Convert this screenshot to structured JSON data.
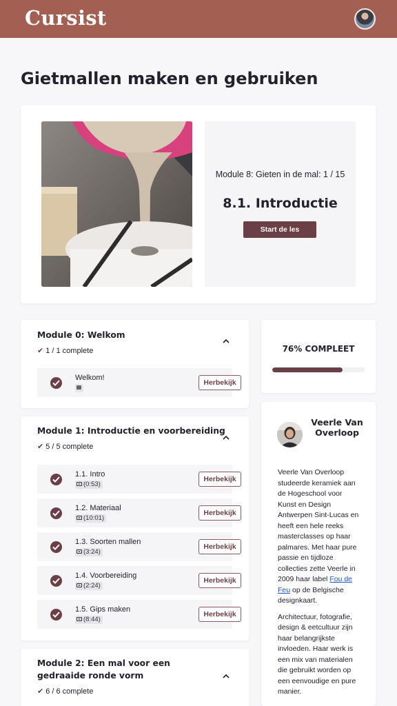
{
  "header": {
    "logo": "Cursist",
    "avatar_icon": "user-avatar"
  },
  "page_title": "Gietmallen maken en gebruiken",
  "hero": {
    "module_label": "Module 8: Gieten in de mal: 1 / 15",
    "lesson_title": "8.1. Introductie",
    "start_label": "Start de les"
  },
  "modules": [
    {
      "title": "Module 0: Welkom",
      "count": "1 / 1 complete",
      "lessons": [
        {
          "title": "Welkom!",
          "duration": "",
          "type": "text",
          "button": "Herbekijk"
        }
      ]
    },
    {
      "title": "Module 1: Introductie en voorbereiding",
      "count": "5 / 5 complete",
      "lessons": [
        {
          "title": "1.1. Intro",
          "duration": "(0:53)",
          "type": "video",
          "button": "Herbekijk"
        },
        {
          "title": "1.2. Materiaal",
          "duration": "(10:01)",
          "type": "video",
          "button": "Herbekijk"
        },
        {
          "title": "1.3. Soorten mallen",
          "duration": "(3:24)",
          "type": "video",
          "button": "Herbekijk"
        },
        {
          "title": "1.4. Voorbereiding",
          "duration": "(2:24)",
          "type": "video",
          "button": "Herbekijk"
        },
        {
          "title": "1.5. Gips maken",
          "duration": "(8:44)",
          "type": "video",
          "button": "Herbekijk"
        }
      ]
    },
    {
      "title": "Module 2: Een mal voor een gedraaide ronde vorm",
      "count": "6 / 6 complete",
      "lessons": []
    }
  ],
  "progress": {
    "label": "76% COMPLEET",
    "percent": 76
  },
  "author": {
    "name": "Veerle Van Overloop",
    "bio_1_pre": "Veerle Van Overloop studeerde keramiek aan de Hogeschool voor Kunst en Design Antwerpen Sint-Lucas en heeft een hele reeks masterclasses op haar palmares. Met haar pure passie en tijdloze collecties zette Veerle in 2009 haar label ",
    "bio_1_link": "Fou de Feu",
    "bio_1_post": " op de Belgische designkaart.",
    "bio_2": "Architectuur, fotografie, design & eetcultuur zijn haar belangrijkste invloeden. Haar werk is een mix van materialen die gebruikt worden op een eenvoudige en pure manier."
  },
  "colors": {
    "brand": "#a35f52",
    "accent": "#6b3f46",
    "background": "#f7f7fa",
    "link": "#1a55d6"
  }
}
